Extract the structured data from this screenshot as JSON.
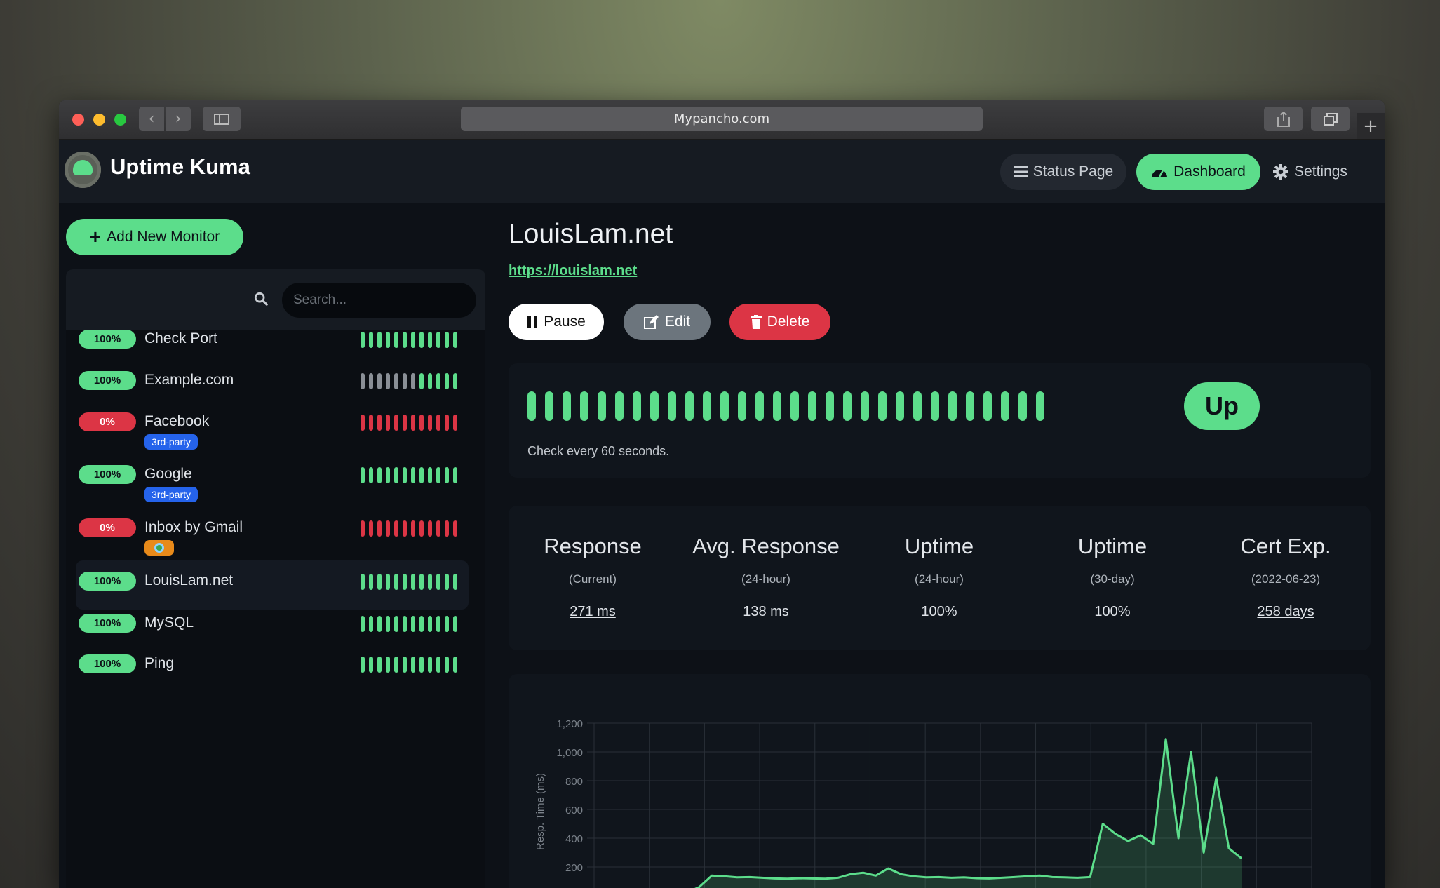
{
  "browser": {
    "url": "Mypancho.com"
  },
  "app": {
    "brand": "Uptime Kuma",
    "nav": {
      "status_page": "Status Page",
      "dashboard": "Dashboard",
      "settings": "Settings"
    },
    "colors": {
      "accent": "#5cdd8b",
      "danger": "#dc3545",
      "tag_blue": "#2563eb"
    }
  },
  "sidebar": {
    "add_button": "Add New Monitor",
    "search_placeholder": "Search...",
    "monitors": [
      {
        "uptime": "100%",
        "name": "Check Port",
        "status": "up",
        "tag": "",
        "beats": "gggggggggggg"
      },
      {
        "uptime": "100%",
        "name": "Example.com",
        "status": "up",
        "tag": "",
        "beats": "eeeeeeeggggg"
      },
      {
        "uptime": "0%",
        "name": "Facebook",
        "status": "down",
        "tag": "3rd-party",
        "beats": "rrrrrrrrrrrr"
      },
      {
        "uptime": "100%",
        "name": "Google",
        "status": "up",
        "tag": "3rd-party",
        "beats": "gggggggggggg"
      },
      {
        "uptime": "0%",
        "name": "Inbox by Gmail",
        "status": "down",
        "tag": "emoji",
        "beats": "rrrrrrrrrrrr"
      },
      {
        "uptime": "100%",
        "name": "LouisLam.net",
        "status": "up",
        "tag": "",
        "beats": "gggggggggggg",
        "active": true
      },
      {
        "uptime": "100%",
        "name": "MySQL",
        "status": "up",
        "tag": "",
        "beats": "gggggggggggg"
      },
      {
        "uptime": "100%",
        "name": "Ping",
        "status": "up",
        "tag": "",
        "beats": "gggggggggggg"
      }
    ]
  },
  "detail": {
    "title": "LouisLam.net",
    "url": "https://louislam.net",
    "buttons": {
      "pause": "Pause",
      "edit": "Edit",
      "delete": "Delete"
    },
    "status": "Up",
    "check_interval_text": "Check every 60 seconds.",
    "beat_count": 30,
    "stats": [
      {
        "title": "Response",
        "sub": "(Current)",
        "value": "271 ms",
        "link": true
      },
      {
        "title": "Avg. Response",
        "sub": "(24-hour)",
        "value": "138 ms",
        "link": false
      },
      {
        "title": "Uptime",
        "sub": "(24-hour)",
        "value": "100%",
        "link": false
      },
      {
        "title": "Uptime",
        "sub": "(30-day)",
        "value": "100%",
        "link": false
      },
      {
        "title": "Cert Exp.",
        "sub": "(2022-06-23)",
        "value": "258 days",
        "link": true
      }
    ]
  },
  "chart_data": {
    "type": "area",
    "ylabel": "Resp. Time (ms)",
    "y_ticks": [
      "1,200",
      "1,000",
      "800",
      "600",
      "400",
      "200"
    ],
    "ylim": [
      0,
      1200
    ],
    "grid": true,
    "series": [
      {
        "values": [
          10,
          12,
          15,
          14,
          18,
          16,
          20,
          22,
          60,
          140,
          135,
          128,
          130,
          125,
          120,
          118,
          122,
          120,
          118,
          125,
          150,
          160,
          140,
          190,
          150,
          135,
          128,
          130,
          125,
          128,
          122,
          120,
          125,
          130,
          135,
          140,
          130,
          128,
          125,
          130,
          500,
          430,
          380,
          420,
          360,
          1090,
          400,
          1000,
          300,
          820,
          330,
          260
        ]
      }
    ]
  }
}
